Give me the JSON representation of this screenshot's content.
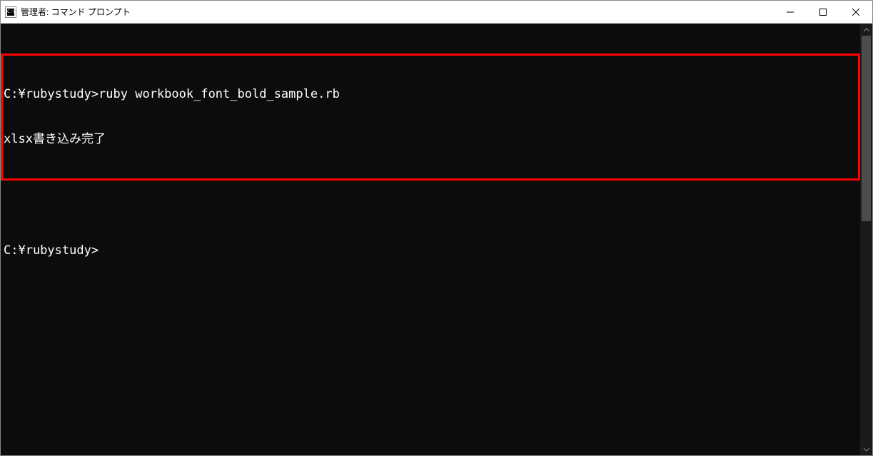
{
  "window": {
    "title": "管理者: コマンド プロンプト",
    "icon_label": "cmd-icon"
  },
  "terminal": {
    "highlighted_lines": [
      "C:¥rubystudy>ruby workbook_font_bold_sample.rb",
      "xlsx書き込み完了"
    ],
    "prompt_line": "C:¥rubystudy>"
  }
}
